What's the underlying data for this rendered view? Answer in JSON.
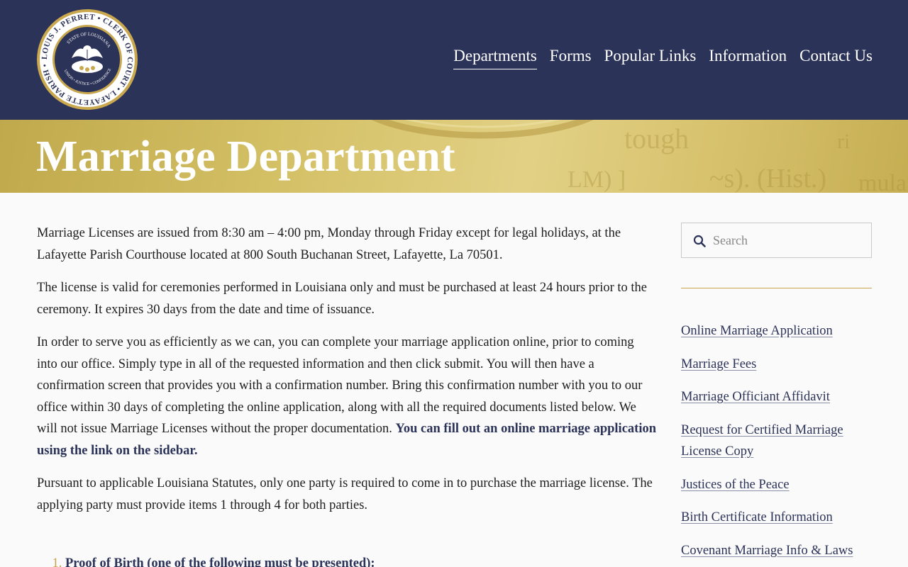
{
  "header": {
    "logo": {
      "ring_text": "LOUIS J. PERRET • CLERK OF COURT • LAFAYETTE PARISH •",
      "inner_text": "STATE OF LOUISIANA",
      "motto": "UNION • JUSTICE • CONFIDENCE"
    },
    "nav": [
      {
        "label": "Departments",
        "active": true
      },
      {
        "label": "Forms"
      },
      {
        "label": "Popular Links"
      },
      {
        "label": "Information"
      },
      {
        "label": "Contact Us"
      }
    ]
  },
  "hero": {
    "title": "Marriage Department"
  },
  "main": {
    "p1": "Marriage Licenses are issued from 8:30 am – 4:00 pm, Monday through Friday except for legal holidays, at the Lafayette Parish Courthouse located at 800 South Buchanan Street, Lafayette, La 70501.",
    "p2": "The license is valid for ceremonies performed in Louisiana only and must be purchased at least 24 hours prior to the ceremony. It expires 30 days from the date and time of issuance.",
    "p3": "In order to serve you as efficiently as we can, you can complete your marriage application online, prior to coming into our office. Simply type in all of the requested information and then click submit. You will then have a confirmation screen that provides you with a confirmation number. Bring this confirmation number with you to our office within 30 days of completing the online application, along with all the required documents listed below. We will not issue Marriage Licenses without the proper documentation.",
    "p3_highlight": "You can fill out an online marriage application using the link on the sidebar.",
    "p4": "Pursuant to applicable Louisiana Statutes, only one party is required to come in to purchase the marriage license. The applying party must provide items 1 through 4 for both parties.",
    "list": [
      "Proof of Birth (one of the following must be presented):"
    ]
  },
  "sidebar": {
    "search_placeholder": "Search",
    "links": [
      "Online Marriage Application",
      "Marriage Fees",
      "Marriage Officiant Affidavit",
      "Request for Certified Marriage License Copy",
      "Justices of the Peace",
      "Birth Certificate Information",
      "Covenant Marriage Info & Laws"
    ]
  },
  "colors": {
    "header_bg": "#2c3358",
    "accent_gold": "#c5a44b",
    "link": "#2c3358"
  },
  "icons": [
    "seal-logo",
    "search-icon"
  ]
}
